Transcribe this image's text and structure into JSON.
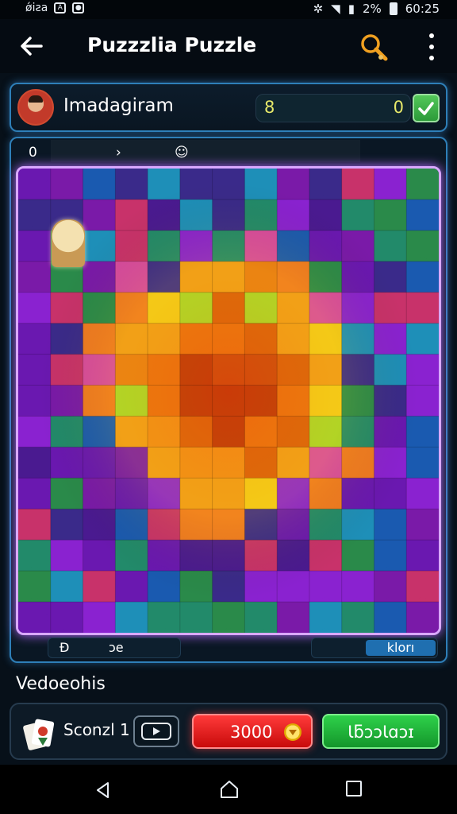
{
  "status_bar": {
    "left_text": "ǿiƨa",
    "right_percent": "2%",
    "time": "60:25"
  },
  "header": {
    "title": "Puzzzlia Puzzle",
    "back_icon": "arrow-left-icon",
    "search_icon": "magnifier-icon",
    "more_icon": "vertical-dots-icon"
  },
  "player": {
    "name": "Imadagiram",
    "score_left": "8",
    "score_right": "0"
  },
  "board": {
    "top_items": [
      "0",
      "›",
      "☺"
    ],
    "bottom_left_number": "Ð",
    "bottom_left_text": "ɔe",
    "bottom_right_label": "klorı"
  },
  "section": {
    "title": "Vedoeohis"
  },
  "bottom_bar": {
    "label": "Sconzl 1",
    "red_button_label": "3000",
    "green_button_label": "ƖƃɔɔƖɑɔɪ"
  },
  "colors": {
    "frame_blue": "#2e7fb8",
    "puzzle_glow": "#b56bff",
    "red_button": "#e01818",
    "green_button": "#22b83c"
  }
}
